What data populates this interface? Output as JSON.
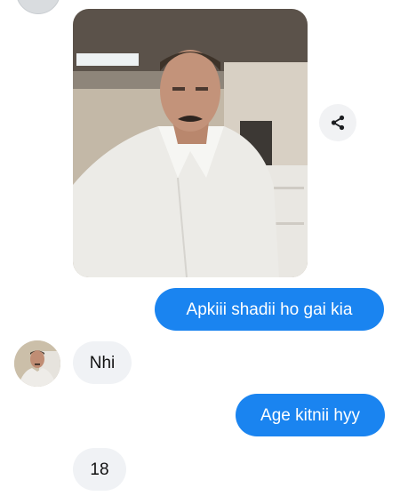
{
  "messages": [
    {
      "direction": "outgoing",
      "text": "Apkiii shadii ho gai kia"
    },
    {
      "direction": "incoming",
      "text": "Nhi"
    },
    {
      "direction": "outgoing",
      "text": "Age kitnii hyy"
    },
    {
      "direction": "incoming",
      "text": "18"
    }
  ],
  "icons": {
    "share": "share-icon",
    "avatar": "avatar",
    "photo": "shared-photo"
  },
  "colors": {
    "outgoing_bubble": "#1a84f0",
    "incoming_bubble": "#f0f2f5",
    "background": "#ffffff"
  }
}
